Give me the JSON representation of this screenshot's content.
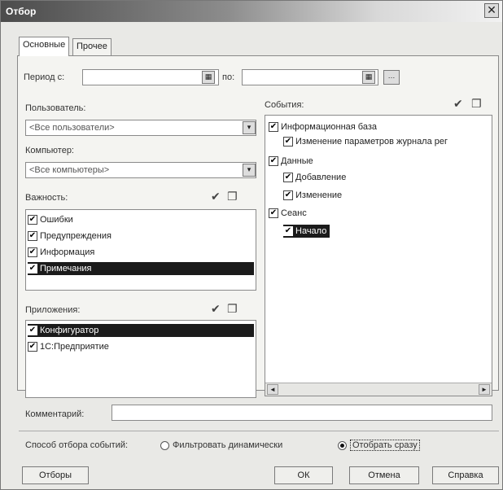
{
  "window": {
    "title": "Отбор",
    "close": "✕"
  },
  "tabs": [
    {
      "label": "Основные"
    },
    {
      "label": "Прочее"
    }
  ],
  "period": {
    "label_from": "Период с:",
    "label_to": "по:",
    "from_value": "",
    "to_value": "",
    "calendar_glyph": "▦",
    "more_glyph": "…"
  },
  "user": {
    "label": "Пользователь:",
    "value": "<Все пользователи>",
    "dropdown": "▾"
  },
  "computer": {
    "label": "Компьютер:",
    "value": "<Все компьютеры>",
    "dropdown": "▾"
  },
  "importance": {
    "label": "Важность:",
    "items": [
      {
        "label": "Ошибки",
        "checked": true
      },
      {
        "label": "Предупреждения",
        "checked": true
      },
      {
        "label": "Информация",
        "checked": true
      },
      {
        "label": "Примечания",
        "checked": true,
        "selected": true
      }
    ]
  },
  "applications": {
    "label": "Приложения:",
    "items": [
      {
        "label": "Конфигуратор",
        "checked": true,
        "selected": true
      },
      {
        "label": "1С:Предприятие",
        "checked": true
      }
    ]
  },
  "events": {
    "label": "События:",
    "items": [
      {
        "label": "Информационная база",
        "checked": true
      },
      {
        "label": "Изменение параметров журнала рег",
        "checked": true
      },
      {
        "label": "Данные",
        "checked": true
      },
      {
        "label": "Добавление",
        "checked": true
      },
      {
        "label": "Изменение",
        "checked": true
      },
      {
        "label": "Сеанс",
        "checked": true
      },
      {
        "label": "Начало",
        "checked": true,
        "selected": true
      }
    ]
  },
  "toolbar_glyphs": {
    "check_all": "✔",
    "uncheck_all": "❐"
  },
  "comment": {
    "label": "Комментарий:",
    "value": ""
  },
  "filter_mode": {
    "label": "Способ отбора событий:",
    "option_dynamic": "Фильтровать динамически",
    "option_immediate": "Отобрать сразу",
    "selected": "immediate"
  },
  "buttons": {
    "filters": "Отборы",
    "ok": "ОК",
    "cancel": "Отмена",
    "help": "Справка"
  },
  "check_glyph": "✔",
  "scroll": {
    "left": "◄",
    "right": "►"
  }
}
